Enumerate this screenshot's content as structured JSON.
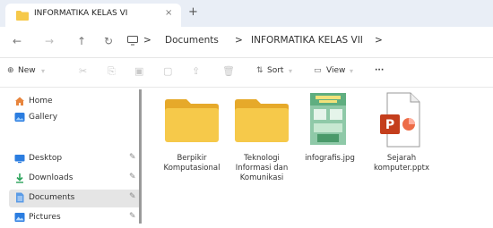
{
  "tab": {
    "title": "INFORMATIKA KELAS VI",
    "close": "×",
    "new_tab": "+"
  },
  "breadcrumb": {
    "items": [
      "Documents",
      "INFORMATIKA KELAS VII"
    ],
    "separator": ">"
  },
  "toolbar": {
    "new_label": "New",
    "sort_label": "Sort",
    "view_label": "View",
    "more": "···"
  },
  "sidebar": {
    "items": [
      {
        "label": "Home",
        "icon": "home-icon"
      },
      {
        "label": "Gallery",
        "icon": "gallery-icon"
      },
      {
        "label": "Desktop",
        "icon": "desktop-icon",
        "pinned": true
      },
      {
        "label": "Downloads",
        "icon": "downloads-icon",
        "pinned": true
      },
      {
        "label": "Documents",
        "icon": "documents-icon",
        "pinned": true,
        "selected": true
      },
      {
        "label": "Pictures",
        "icon": "pictures-icon",
        "pinned": true
      }
    ]
  },
  "files": [
    {
      "name": "Berpikir Komputasional",
      "type": "folder"
    },
    {
      "name": "Teknologi Informasi dan Komunikasi",
      "type": "folder"
    },
    {
      "name": "infografis.jpg",
      "type": "image"
    },
    {
      "name": "Sejarah komputer.pptx",
      "type": "pptx"
    }
  ],
  "colors": {
    "folder": "#f6c94a",
    "folder_dark": "#e6a92a",
    "pptx": "#c43e1c",
    "accent": "#0067c0"
  }
}
